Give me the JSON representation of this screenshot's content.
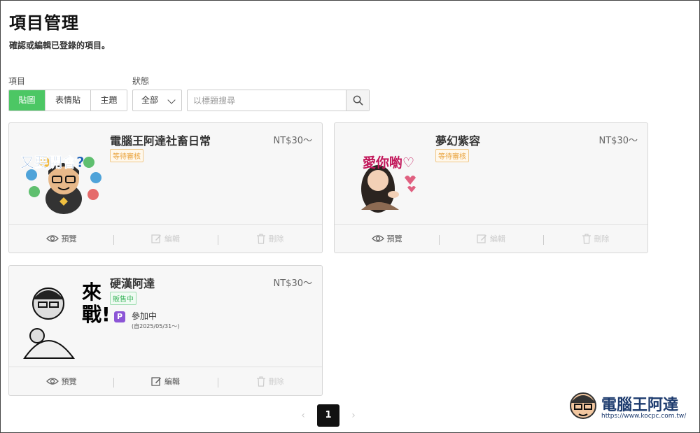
{
  "header": {
    "title": "項目管理",
    "description": "確認或編輯已登錄的項目。"
  },
  "filters": {
    "type_label": "項目",
    "types": [
      {
        "label": "貼圖",
        "active": true
      },
      {
        "label": "表情貼",
        "active": false
      },
      {
        "label": "主題",
        "active": false
      }
    ],
    "status_label": "狀態",
    "status_value": "全部",
    "search_placeholder": "以標題搜尋"
  },
  "items": [
    {
      "name": "電腦王阿達社畜日常",
      "price": "NT$30〜",
      "status": "等待審核",
      "thumb_text": "又要開會?",
      "actions": {
        "preview": "預覽",
        "edit": "編輯",
        "delete": "刪除"
      }
    },
    {
      "name": "夢幻紫容",
      "price": "NT$30〜",
      "status": "等待審核",
      "thumb_text": "愛你喲♡",
      "actions": {
        "preview": "預覽",
        "edit": "編輯",
        "delete": "刪除"
      }
    },
    {
      "name": "硬漢阿達",
      "price": "NT$30〜",
      "status": "販售中",
      "thumb_text": "來戰!",
      "promo": {
        "icon": "P",
        "label": "參加中",
        "period": "(自2025/05/31〜)"
      },
      "actions": {
        "preview": "預覽",
        "edit": "編輯",
        "delete": "刪除"
      }
    }
  ],
  "pagination": {
    "current": "1"
  },
  "watermark": {
    "title": "電腦王阿達",
    "url": "https://www.kocpc.com.tw/"
  },
  "colors": {
    "accent": "#4cc764",
    "pending": "#e9a23b",
    "sale": "#3bb55c",
    "promo": "#8c55d6"
  }
}
